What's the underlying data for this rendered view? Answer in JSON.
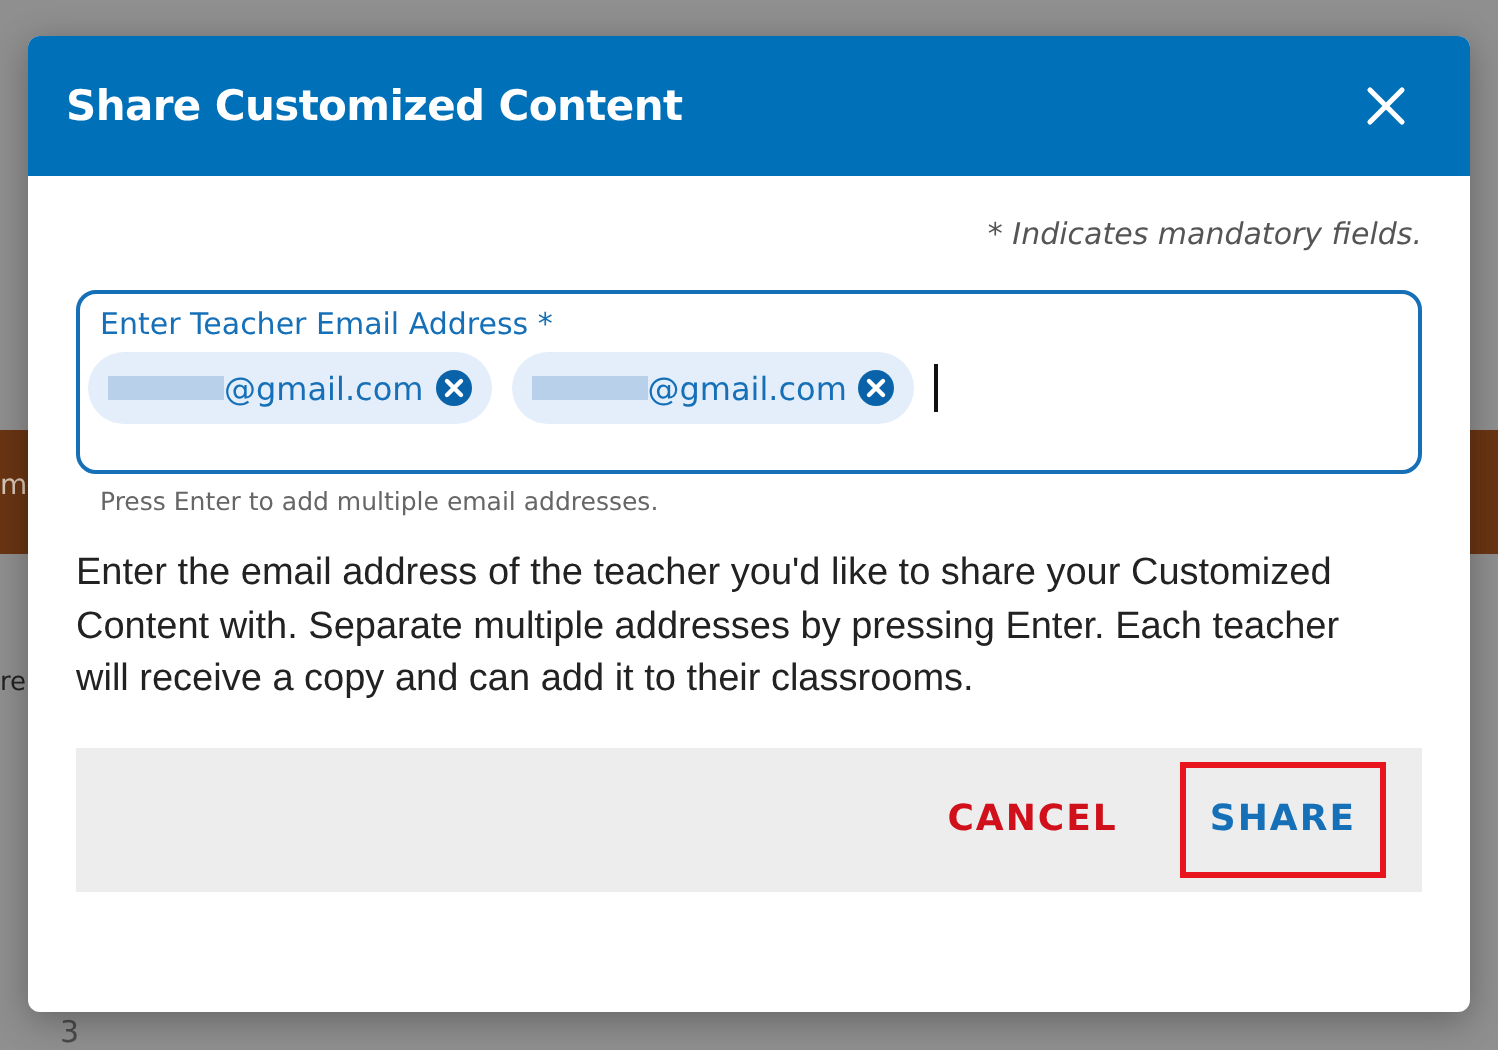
{
  "backdrop": {
    "fragments": [
      "m",
      "re",
      "3"
    ]
  },
  "dialog": {
    "title": "Share Customized Content",
    "mandatory_note": "* Indicates mandatory fields.",
    "email_field": {
      "label": "Enter Teacher Email Address *",
      "chips": [
        {
          "text": "@gmail.com"
        },
        {
          "text": "@gmail.com"
        }
      ],
      "hint": "Press Enter to add multiple email addresses."
    },
    "description": "Enter the email address of the teacher you'd like to share your Customized Content with. Separate multiple addresses by pressing Enter. Each teacher will receive a copy and can add it to their classrooms.",
    "buttons": [
      {
        "label": "CANCEL",
        "kind": "cancel",
        "highlighted": false
      },
      {
        "label": "SHARE",
        "kind": "primary",
        "highlighted": true
      }
    ]
  }
}
